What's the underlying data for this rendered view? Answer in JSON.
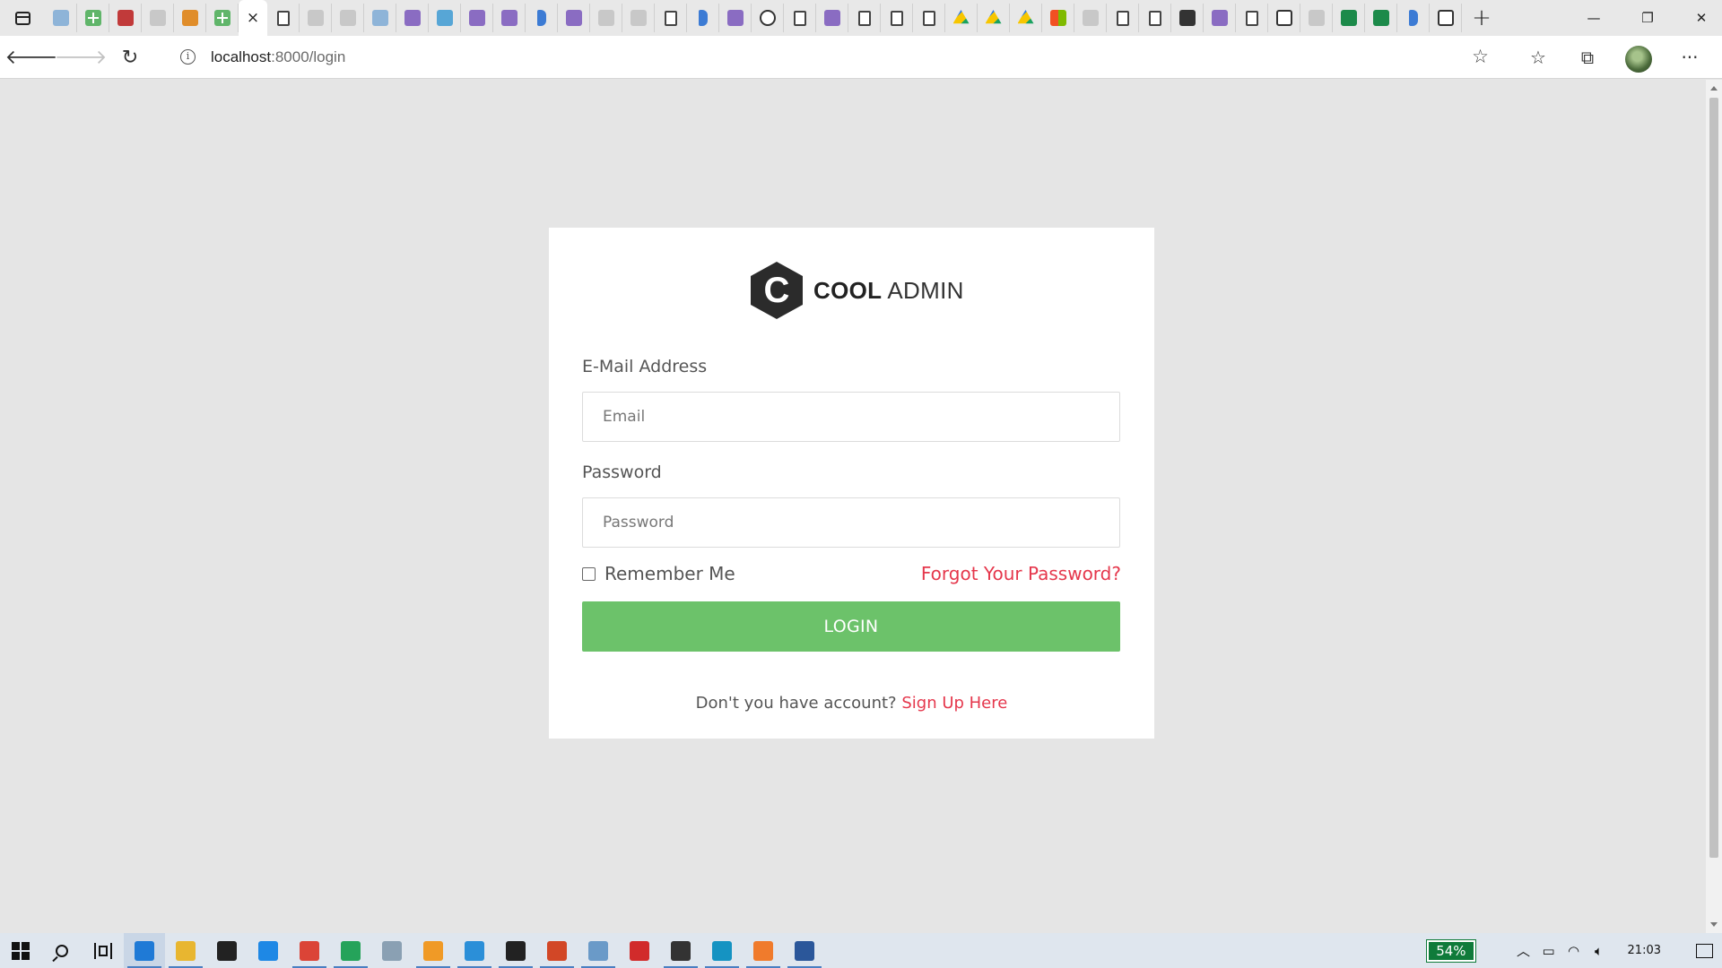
{
  "browser": {
    "active_tab_close_label": "×",
    "new_tab_label": "+",
    "window": {
      "minimize": "—",
      "restore": "❐",
      "close": "✕"
    },
    "address_bar": {
      "host": "localhost",
      "path": ":8000/login",
      "info_icon_label": "i"
    },
    "toolbar_icons": [
      "star-add-icon",
      "favorites-icon",
      "collections-icon",
      "avatar",
      "more-icon"
    ],
    "more_label": "···"
  },
  "tabs": [
    {
      "icon": "paleblue"
    },
    {
      "icon": "plus"
    },
    {
      "icon": "red"
    },
    {
      "icon": "gray"
    },
    {
      "icon": "orange"
    },
    {
      "icon": "plus"
    },
    {
      "icon": "active"
    },
    {
      "icon": "doc"
    },
    {
      "icon": "gray"
    },
    {
      "icon": "gray"
    },
    {
      "icon": "paleblue"
    },
    {
      "icon": "purple"
    },
    {
      "icon": "blueT"
    },
    {
      "icon": "purple"
    },
    {
      "icon": "purple"
    },
    {
      "icon": "bing"
    },
    {
      "icon": "purple"
    },
    {
      "icon": "gray"
    },
    {
      "icon": "gray"
    },
    {
      "icon": "doc"
    },
    {
      "icon": "bing"
    },
    {
      "icon": "purple"
    },
    {
      "icon": "gh"
    },
    {
      "icon": "doc"
    },
    {
      "icon": "purple"
    },
    {
      "icon": "doc"
    },
    {
      "icon": "doc"
    },
    {
      "icon": "doc"
    },
    {
      "icon": "drive"
    },
    {
      "icon": "drive"
    },
    {
      "icon": "drive"
    },
    {
      "icon": "grid"
    },
    {
      "icon": "gray"
    },
    {
      "icon": "doc"
    },
    {
      "icon": "doc"
    },
    {
      "icon": "dark"
    },
    {
      "icon": "purple"
    },
    {
      "icon": "doc"
    },
    {
      "icon": "cal"
    },
    {
      "icon": "gray"
    },
    {
      "icon": "green"
    },
    {
      "icon": "green"
    },
    {
      "icon": "bing"
    },
    {
      "icon": "cal"
    }
  ],
  "login": {
    "logo": {
      "letter": "C",
      "brand_bold": "COOL",
      "brand_light": " ADMIN"
    },
    "email_label": "E-Mail Address",
    "email_placeholder": "Email",
    "password_label": "Password",
    "password_placeholder": "Password",
    "remember_label": "Remember Me",
    "forgot_label": "Forgot Your Password?",
    "login_button": "LOGIN",
    "signup_prompt": "Don't you have account?",
    "signup_link": "Sign Up Here"
  },
  "colors": {
    "login_button": "#6cc26a",
    "link_red": "#e5374c",
    "page_background": "#e5e5e5"
  },
  "taskbar": {
    "apps": [
      {
        "name": "edge-app-icon",
        "color": "#1f7ad6",
        "running": true,
        "focused": true
      },
      {
        "name": "file-explorer-app-icon",
        "color": "#e8b630",
        "running": true
      },
      {
        "name": "mail-app-icon",
        "color": "#222222",
        "running": false
      },
      {
        "name": "l-app-icon",
        "color": "#1e88e5",
        "running": false
      },
      {
        "name": "chrome-app-icon",
        "color": "#db4437",
        "running": true
      },
      {
        "name": "whatsapp-app-icon",
        "color": "#25a35a",
        "running": true
      },
      {
        "name": "photos-app-icon",
        "color": "#8aa0b3",
        "running": false
      },
      {
        "name": "sublime-app-icon",
        "color": "#f09a26",
        "running": true
      },
      {
        "name": "vscode-app-icon",
        "color": "#2b8fd8",
        "running": true
      },
      {
        "name": "terminal-app-icon",
        "color": "#222222",
        "running": true
      },
      {
        "name": "powerpoint-app-icon",
        "color": "#d24726",
        "running": true
      },
      {
        "name": "tool-app-icon",
        "color": "#6a9ac8",
        "running": true
      },
      {
        "name": "acrobat-app-icon",
        "color": "#d12b2b",
        "running": false
      },
      {
        "name": "image-viewer-app-icon",
        "color": "#333333",
        "running": true
      },
      {
        "name": "arduino-app-icon",
        "color": "#1593c2",
        "running": true
      },
      {
        "name": "xampp-app-icon",
        "color": "#f07b2c",
        "running": true
      },
      {
        "name": "word-app-icon",
        "color": "#2b579a",
        "running": true
      }
    ],
    "battery_percent": "54%",
    "clock": "21:03"
  }
}
